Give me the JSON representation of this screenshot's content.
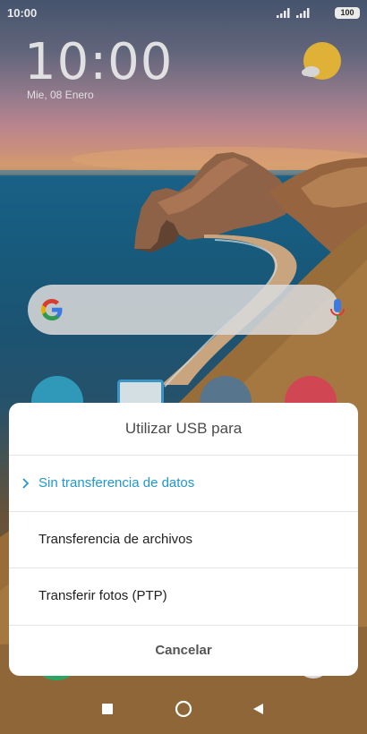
{
  "status_bar": {
    "time": "10:00",
    "battery": "100",
    "signal_icon": "signal-bars-icon",
    "battery_icon": "battery-icon"
  },
  "clock_widget": {
    "time": "10:00",
    "date": "Mie, 08 Enero",
    "weather_icon": "partly-cloudy-icon"
  },
  "search": {
    "google_icon": "google-g-icon",
    "mic_icon": "microphone-icon"
  },
  "dialog": {
    "title": "Utilizar USB para",
    "options": [
      {
        "label": "Sin transferencia de datos",
        "selected": true
      },
      {
        "label": "Transferencia de archivos",
        "selected": false
      },
      {
        "label": "Transferir fotos (PTP)",
        "selected": false
      }
    ],
    "cancel_label": "Cancelar"
  },
  "nav": {
    "recent_icon": "square-recents-icon",
    "home_icon": "circle-home-icon",
    "back_icon": "triangle-back-icon"
  },
  "colors": {
    "accent": "#2196d3",
    "dialog_bg": "#ffffff",
    "divider": "#e4e4e4"
  }
}
